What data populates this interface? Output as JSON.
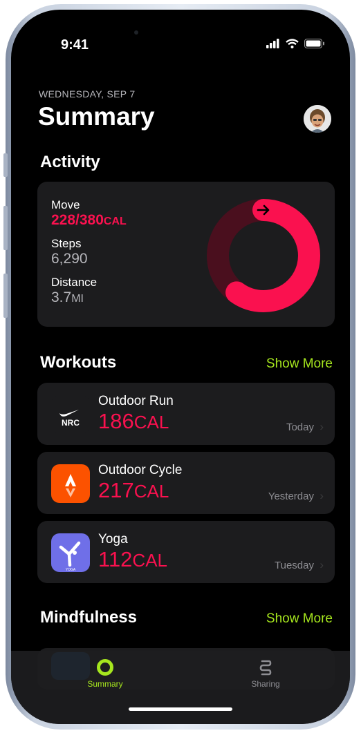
{
  "status_bar": {
    "time": "9:41"
  },
  "header": {
    "date": "WEDNESDAY, SEP 7",
    "title": "Summary"
  },
  "activity": {
    "section_title": "Activity",
    "move": {
      "label": "Move",
      "value": "228/380",
      "unit": "CAL",
      "progress": 0.6
    },
    "steps": {
      "label": "Steps",
      "value": "6,290"
    },
    "distance": {
      "label": "Distance",
      "value": "3.7",
      "unit": "MI"
    }
  },
  "workouts": {
    "section_title": "Workouts",
    "show_more": "Show More",
    "items": [
      {
        "name": "Outdoor Run",
        "calories": "186",
        "unit": "CAL",
        "date": "Today",
        "app_badge": "NRC"
      },
      {
        "name": "Outdoor Cycle",
        "calories": "217",
        "unit": "CAL",
        "date": "Yesterday"
      },
      {
        "name": "Yoga",
        "calories": "112",
        "unit": "CAL",
        "date": "Tuesday",
        "app_badge": "YOGA"
      }
    ]
  },
  "mindfulness": {
    "section_title": "Mindfulness",
    "show_more": "Show More"
  },
  "tab_bar": {
    "summary": "Summary",
    "sharing": "Sharing"
  },
  "colors": {
    "move": "#fa114f",
    "accent": "#a6e61e",
    "card": "#1c1c1e"
  }
}
